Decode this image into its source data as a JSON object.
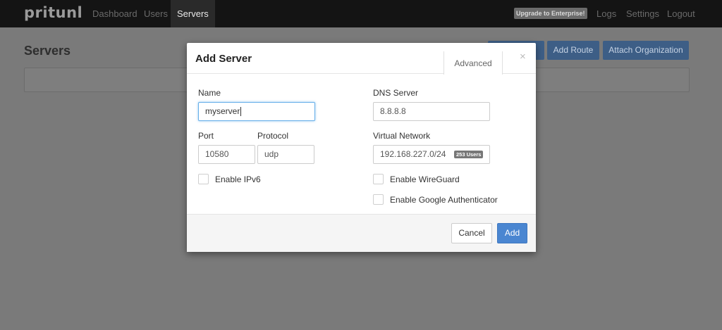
{
  "navbar": {
    "brand": "pritunl",
    "items": [
      {
        "label": "Dashboard"
      },
      {
        "label": "Users"
      },
      {
        "label": "Servers"
      }
    ],
    "upgrade_label": "Upgrade to Enterprise!",
    "right_items": [
      {
        "label": "Logs"
      },
      {
        "label": "Settings"
      },
      {
        "label": "Logout"
      }
    ]
  },
  "page": {
    "title": "Servers",
    "buttons": [
      {
        "label": "Add Route"
      },
      {
        "label": "Attach Organization"
      }
    ]
  },
  "modal": {
    "title": "Add Server",
    "advanced_tab": "Advanced",
    "close_glyph": "×",
    "name": {
      "label": "Name",
      "value": "myserver"
    },
    "dns": {
      "label": "DNS Server",
      "value": "8.8.8.8"
    },
    "port": {
      "label": "Port",
      "value": "10580"
    },
    "protocol": {
      "label": "Protocol",
      "value": "udp"
    },
    "network": {
      "label": "Virtual Network",
      "value": "192.168.227.0/24",
      "badge": "253 Users"
    },
    "checkboxes": {
      "ipv6": {
        "label": "Enable IPv6",
        "checked": false
      },
      "wireguard": {
        "label": "Enable WireGuard",
        "checked": false
      },
      "google_auth": {
        "label": "Enable Google Authenticator",
        "checked": false
      }
    },
    "footer": {
      "cancel_label": "Cancel",
      "add_label": "Add"
    }
  }
}
